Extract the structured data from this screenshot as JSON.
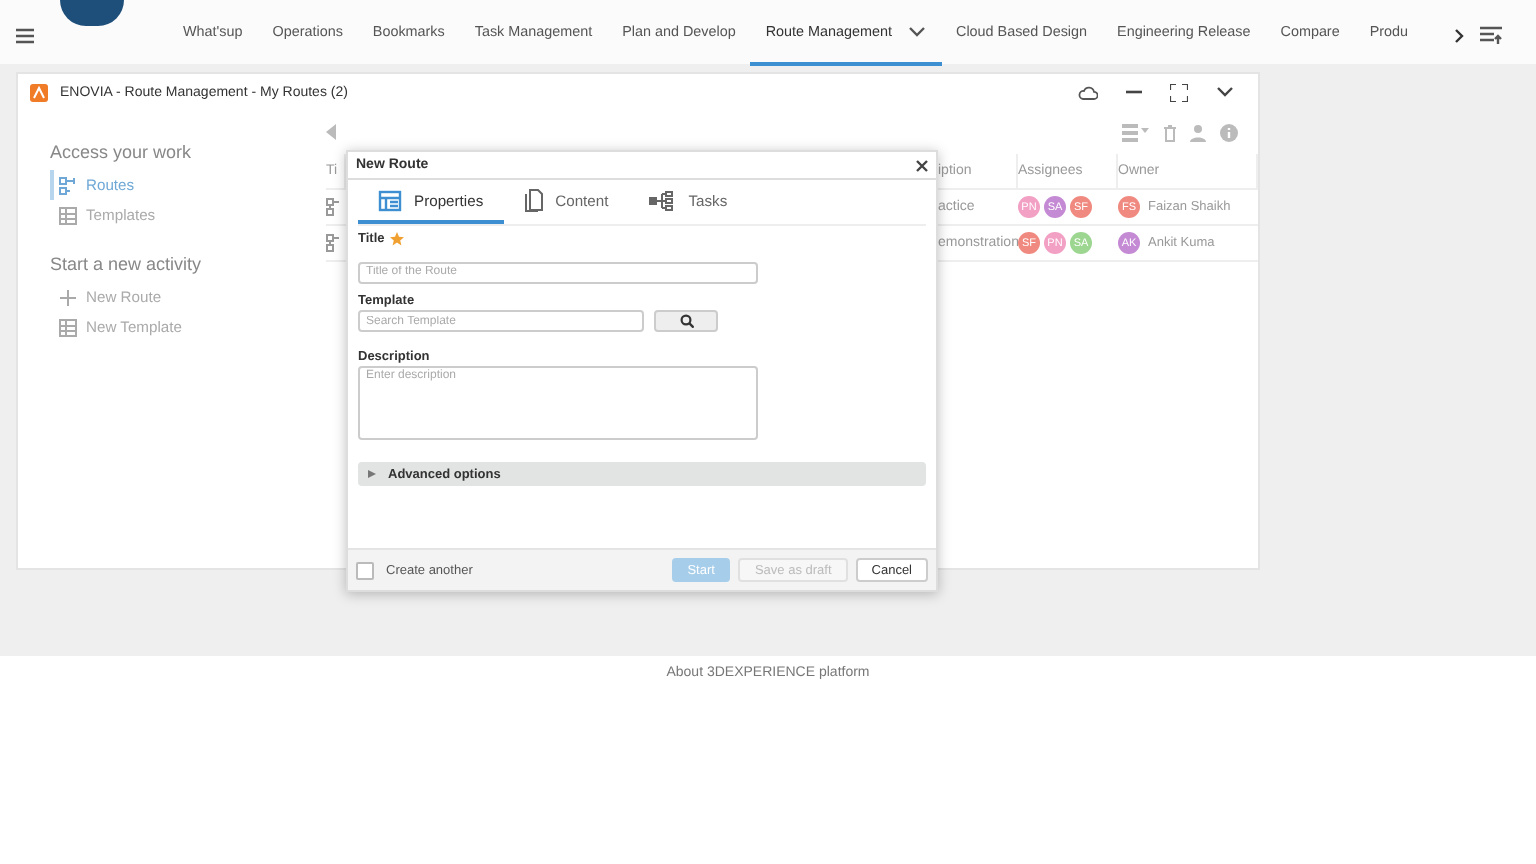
{
  "top_tabs": [
    {
      "label": "What'sup",
      "selected": false
    },
    {
      "label": "Operations",
      "selected": false
    },
    {
      "label": "Bookmarks",
      "selected": false
    },
    {
      "label": "Task Management",
      "selected": false
    },
    {
      "label": "Plan and Develop",
      "selected": false
    },
    {
      "label": "Route Management",
      "selected": true
    },
    {
      "label": "Cloud Based Design",
      "selected": false
    },
    {
      "label": "Engineering Release",
      "selected": false
    },
    {
      "label": "Compare",
      "selected": false
    },
    {
      "label": "Produ",
      "selected": false
    }
  ],
  "widget": {
    "title": "ENOVIA - Route Management - My Routes (2)"
  },
  "sidebar": {
    "sections": [
      {
        "heading": "Access your work",
        "items": [
          {
            "label": "Routes",
            "selected": true
          },
          {
            "label": "Templates",
            "selected": false
          }
        ]
      },
      {
        "heading": "Start a new activity",
        "items": [
          {
            "label": "New Route",
            "selected": false
          },
          {
            "label": "New Template",
            "selected": false
          }
        ]
      }
    ]
  },
  "table": {
    "columns": [
      "Ti",
      "iption",
      "Assignees",
      "Owner"
    ],
    "rows": [
      {
        "column_2": "actice",
        "assignees": [
          {
            "initials": "PN",
            "color": "#f2a0c4"
          },
          {
            "initials": "SA",
            "color": "#c58ad4"
          },
          {
            "initials": "SF",
            "color": "#f08a80"
          }
        ],
        "owner": {
          "initials": "FS",
          "color": "#f08a80",
          "name": "Faizan Shaikh"
        }
      },
      {
        "column_2": "emonstration",
        "assignees": [
          {
            "initials": "SF",
            "color": "#f08a80"
          },
          {
            "initials": "PN",
            "color": "#f2a0c4"
          },
          {
            "initials": "SA",
            "color": "#9cd690"
          }
        ],
        "owner": {
          "initials": "AK",
          "color": "#c58ad4",
          "name": "Ankit Kuma"
        }
      }
    ]
  },
  "dialog": {
    "title": "New Route",
    "tabs": [
      {
        "label": "Properties",
        "selected": true
      },
      {
        "label": "Content",
        "selected": false
      },
      {
        "label": "Tasks",
        "selected": false
      }
    ],
    "fields": [
      {
        "kind": "text",
        "label": "Title",
        "required": true,
        "placeholder": "Title of the Route"
      },
      {
        "kind": "search",
        "label": "Template",
        "required": false,
        "placeholder": "Search Template"
      },
      {
        "kind": "textarea",
        "label": "Description",
        "required": false,
        "placeholder": "Enter description"
      }
    ],
    "advanced": {
      "label": "Advanced options",
      "expanded": false
    },
    "create_another": {
      "label": "Create another",
      "checked": false
    },
    "buttons": [
      {
        "label": "Start",
        "kind": "primary",
        "disabled": true
      },
      {
        "label": "Save as draft",
        "kind": "secondary",
        "disabled": true
      },
      {
        "label": "Cancel",
        "kind": "secondary",
        "disabled": false
      }
    ]
  },
  "footer": {
    "text": "About 3DEXPERIENCE platform"
  }
}
